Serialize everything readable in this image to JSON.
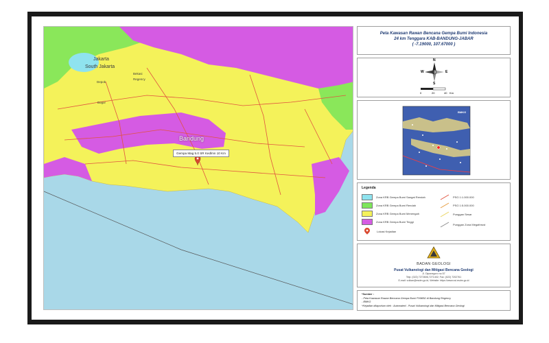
{
  "title": {
    "line1": "Peta Kawasan Rawan Bencana Gempa Bumi Indonesia",
    "line2": "24 km Tenggara KAB-BANDUNG-JABAR",
    "line3": "( -7.19000, 107.67000 )"
  },
  "compass": {
    "north": "N",
    "south": "S",
    "east": "E",
    "west": "W",
    "scale_ticks": [
      "0",
      "20",
      "40"
    ],
    "scale_unit": "Km"
  },
  "inset": {
    "label": "BMKG"
  },
  "legend": {
    "title": "Legenda",
    "zones": [
      {
        "label": "Zona KRB Gempa Bumi Sangat Rendah",
        "color": "#8fe3ef"
      },
      {
        "label": "Zona KRB Gempa Bumi Rendah",
        "color": "#7ee65a"
      },
      {
        "label": "Zona KRB Gempa Bumi Menengah",
        "color": "#f4f25a"
      },
      {
        "label": "Zona KRB Gempa Bumi Tinggi",
        "color": "#d55be3"
      }
    ],
    "event_label": "Lokasi Kejadian",
    "lines": [
      {
        "label": "PSG 1:1.000.000",
        "color": "#e0533f"
      },
      {
        "label": "PSG 1:5.000.000",
        "color": "#e59a3a"
      },
      {
        "label": "Punggan Sesar",
        "color": "#e9d35a"
      },
      {
        "label": "Punggan Zona Megathrust",
        "color": "#8a8a8a"
      }
    ]
  },
  "agency": {
    "logo_caption": "BADAN GEOLOGI",
    "org_name": "Pusat Vulkanologi dan Mitigasi Bencana Geologi",
    "address": "Jl. Diponegoro no 57",
    "phone": "Telp: (022) 7272606,7271402; Fax: (022) 7202761",
    "email": "E-mail: vulkan@esdm.go.id, Website: https://www.vsi.esdm.go.id"
  },
  "notes": {
    "head": "*Sumber :",
    "items": [
      "- Peta Kawasan Rawan Bencana Gempa Bumi PVMBG di Bandung Regency",
      "- BMKG",
      "*Kejadian dilaporkan oleh : Automated - Pusat Vulkanologi dan Mitigasi Bencana Geologi"
    ]
  },
  "map": {
    "event_callout": "Gempa Mag 5.0 SR Kedlmn 10 Km",
    "places": {
      "jakarta": "Jakarta",
      "south_jakarta": "South Jakarta",
      "bekasi": "Bekasi",
      "regency": "Regency",
      "depok": "Depok",
      "bogor": "Bogor",
      "bandung": "Bandung"
    },
    "colors": {
      "sea": "#a9d8e8",
      "zone_very_low": "#8fe3ef",
      "zone_low": "#7ee65a",
      "zone_medium": "#f4f25a",
      "zone_high": "#d55be3",
      "fault": "#e0533f"
    }
  }
}
